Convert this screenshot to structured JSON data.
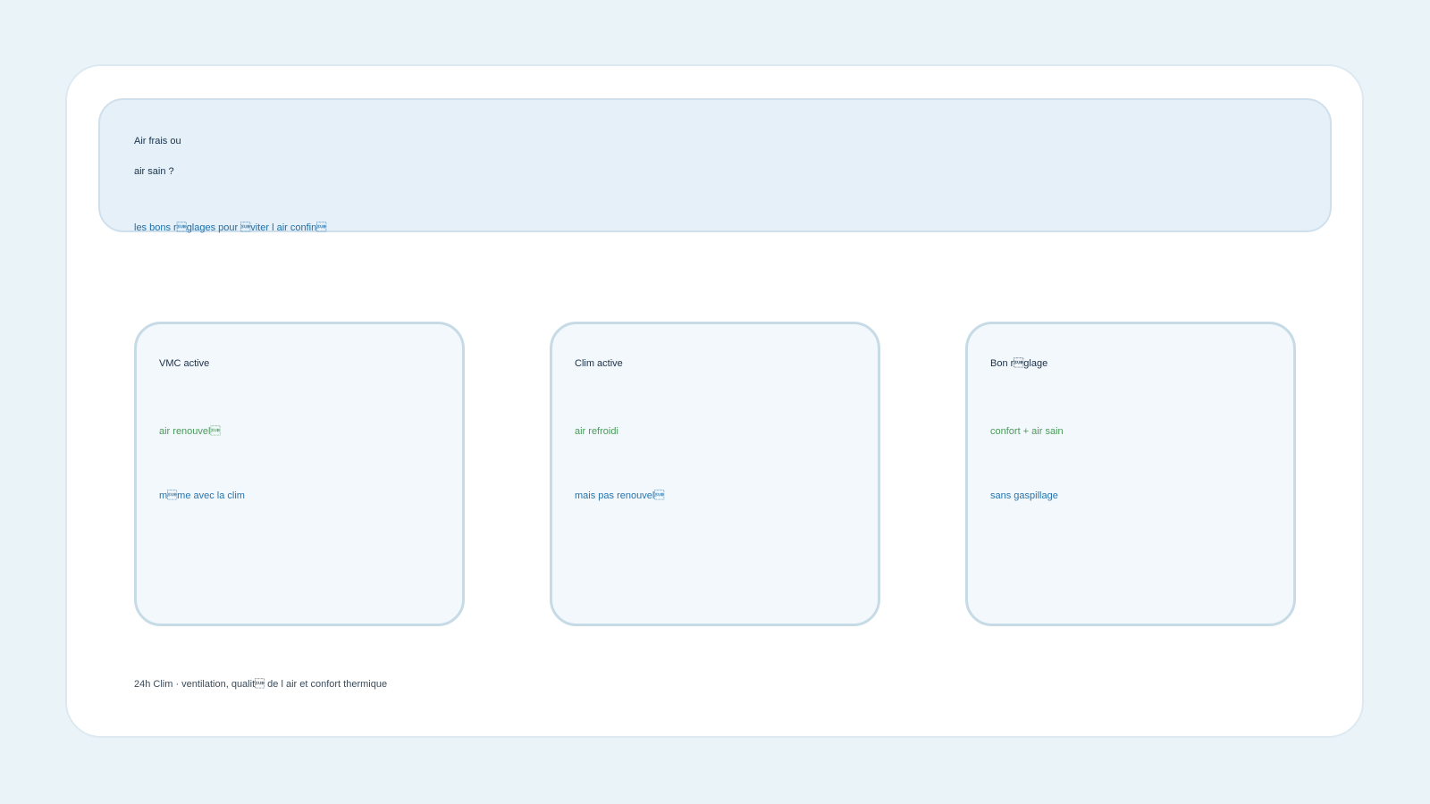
{
  "hero": {
    "title_line1": "Air frais ou",
    "title_line2": "air sain ?",
    "subtitle": "les bons r\u001aglages pour \u001aviter l air confin\u001a"
  },
  "cards": [
    {
      "title": "VMC active",
      "highlight": "air renouvel\u001a",
      "detail": "m\u001ame avec la clim"
    },
    {
      "title": "Clim active",
      "highlight": "air refroidi",
      "detail": "mais pas renouvel\u001a"
    },
    {
      "title": "Bon r\u001aglage",
      "highlight": "confort + air sain",
      "detail": "sans gaspillage"
    }
  ],
  "footer": {
    "text": "24h Clim · ventilation, qualit\u001a de l air et confort thermique"
  },
  "colors": {
    "page_background": "#eaf3f8",
    "panel_background": "#ffffff",
    "hero_background": "#e5f0f9",
    "card_background": "#f3f8fc",
    "card_border": "#c7dbe6",
    "title_text": "#1b2f45",
    "accent_blue": "#2774ad",
    "accent_green": "#4b9a5a"
  }
}
